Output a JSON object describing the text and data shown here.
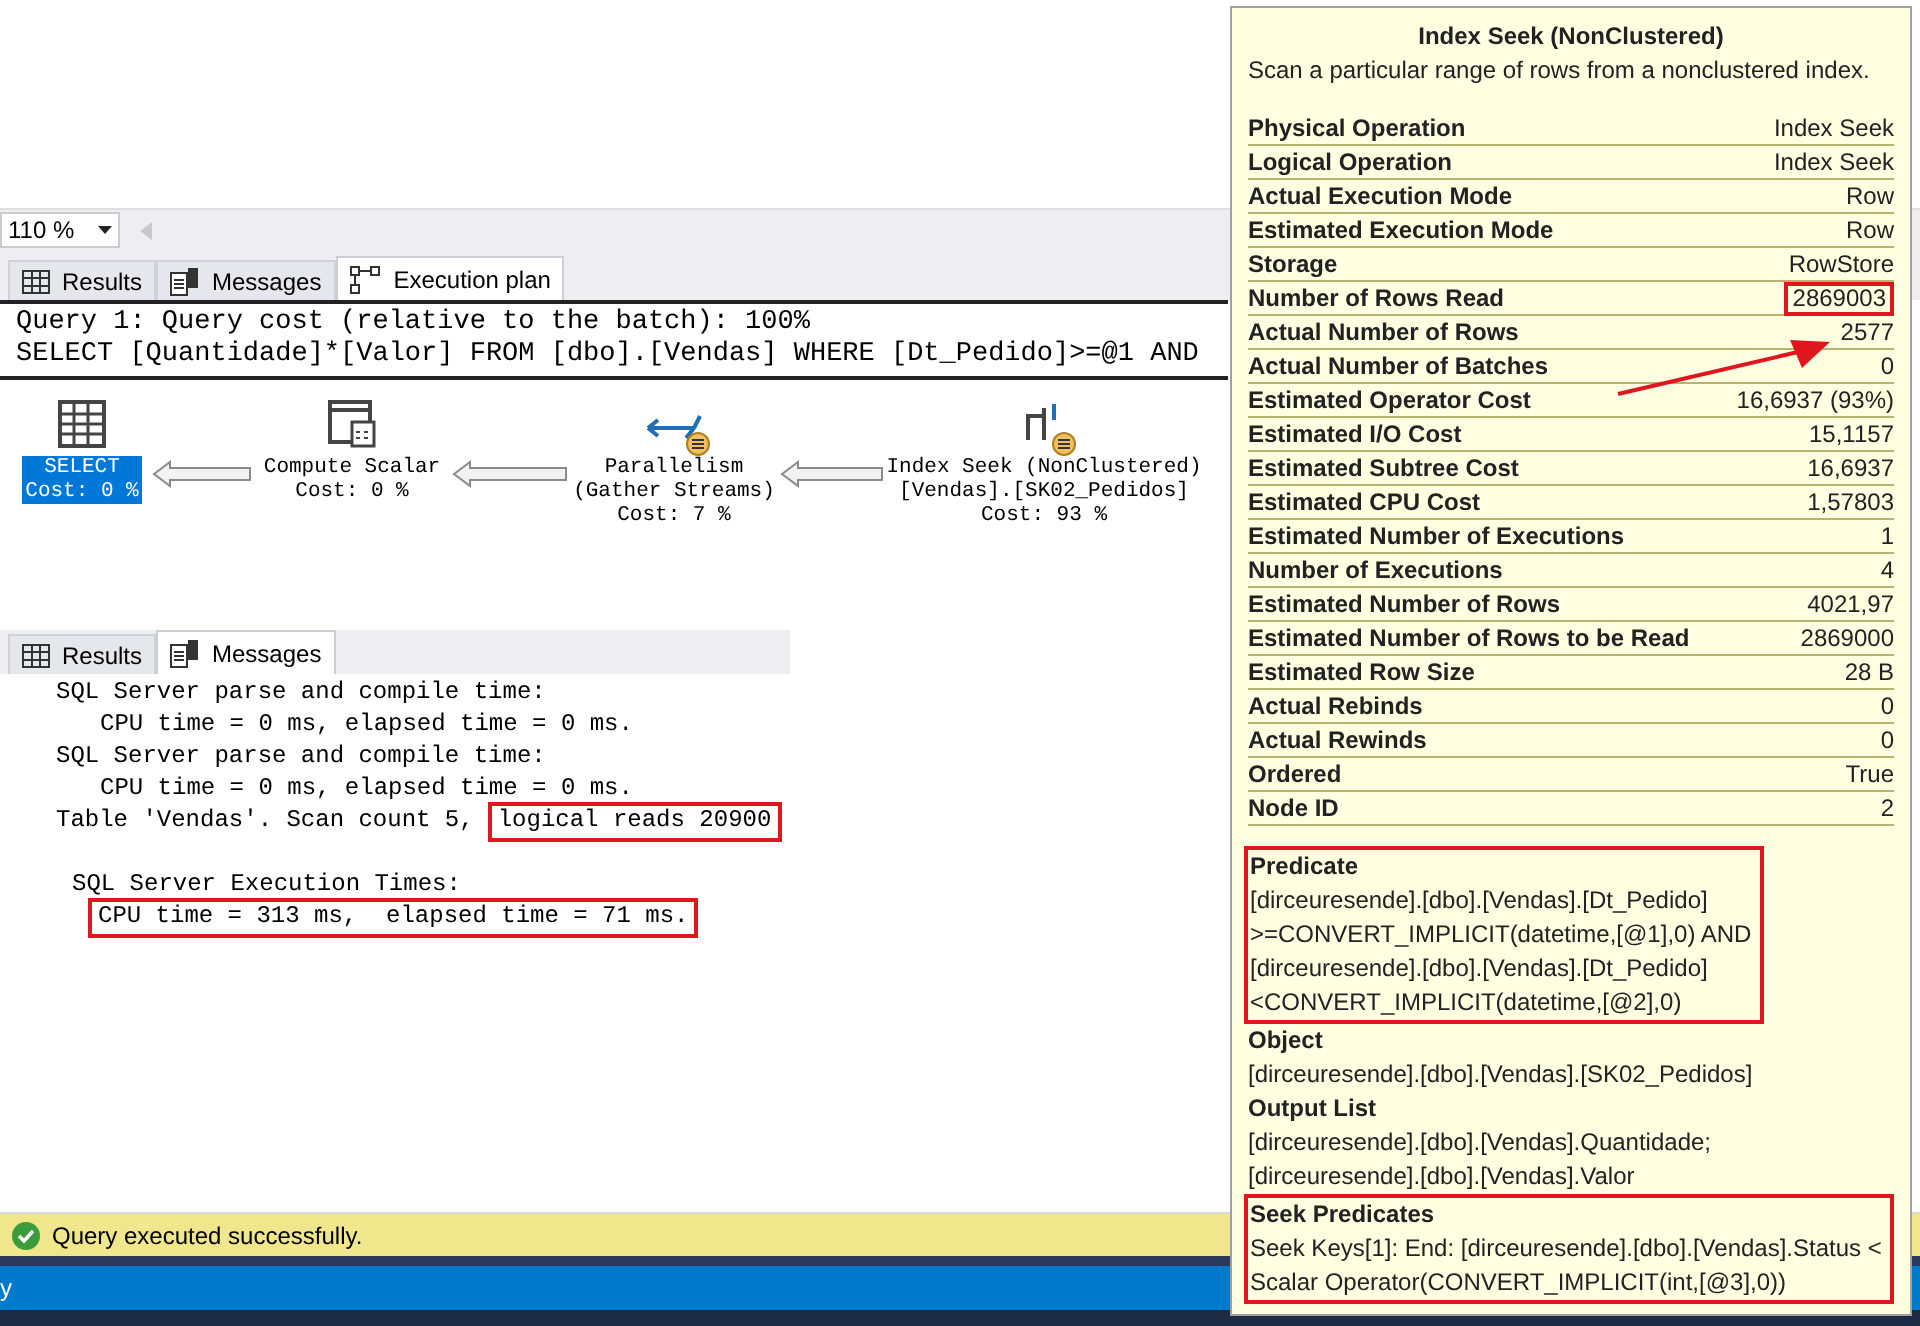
{
  "zoom": {
    "value": "110 %"
  },
  "tabs": [
    {
      "label": "Results",
      "kind": "grid",
      "selected": false
    },
    {
      "label": "Messages",
      "kind": "messages",
      "selected": false
    },
    {
      "label": "Execution plan",
      "kind": "plan",
      "selected": true
    }
  ],
  "query": {
    "header": "Query 1: Query cost (relative to the batch): 100%",
    "statement": "SELECT [Quantidade]*[Valor] FROM [dbo].[Vendas] WHERE [Dt_Pedido]>=@1 AND"
  },
  "plan_nodes": [
    {
      "kind": "select",
      "lines": [
        "SELECT"
      ],
      "cost": "Cost: 0 %",
      "selected": true,
      "parallel": false
    },
    {
      "kind": "compute",
      "lines": [
        "Compute Scalar"
      ],
      "cost": "Cost: 0 %",
      "selected": false,
      "parallel": false
    },
    {
      "kind": "parallelism",
      "lines": [
        "Parallelism",
        "(Gather Streams)"
      ],
      "cost": "Cost: 7 %",
      "selected": false,
      "parallel": true
    },
    {
      "kind": "seek",
      "lines": [
        "Index Seek (NonClustered)",
        "[Vendas].[SK02_Pedidos]"
      ],
      "cost": "Cost: 93 %",
      "selected": false,
      "parallel": true
    }
  ],
  "lower_tabs": [
    {
      "label": "Results",
      "kind": "grid",
      "selected": false
    },
    {
      "label": "Messages",
      "kind": "messages",
      "selected": true
    }
  ],
  "messages": [
    {
      "kind": "heading",
      "segments": [
        {
          "text": "SQL Server parse and compile time:",
          "highlighted": false
        }
      ]
    },
    {
      "kind": "detail",
      "segments": [
        {
          "text": "CPU time = 0 ms, elapsed time = 0 ms.",
          "highlighted": false
        }
      ]
    },
    {
      "kind": "heading",
      "segments": [
        {
          "text": "SQL Server parse and compile time:",
          "highlighted": false
        }
      ]
    },
    {
      "kind": "detail",
      "segments": [
        {
          "text": "CPU time = 0 ms, elapsed time = 0 ms.",
          "highlighted": false
        }
      ]
    },
    {
      "kind": "heading",
      "segments": [
        {
          "text": "Table 'Vendas'. Scan count 5,",
          "highlighted": false
        },
        {
          "text": "logical reads 20900",
          "highlighted": true
        }
      ]
    },
    {
      "kind": "blank"
    },
    {
      "kind": "stat_heading",
      "segments": [
        {
          "text": "SQL Server Execution Times:",
          "highlighted": false
        }
      ]
    },
    {
      "kind": "stat_detail",
      "segments": [
        {
          "text": "CPU time = 313 ms,  elapsed time = 71 ms.",
          "highlighted": true
        }
      ]
    }
  ],
  "status_bar": {
    "text": "Query executed successfully."
  },
  "bottom_bar": {
    "text": "y"
  },
  "tooltip": {
    "title": "Index Seek (NonClustered)",
    "description": "Scan a particular range of rows from a nonclustered index.",
    "properties": [
      {
        "label": "Physical Operation",
        "value": "Index Seek",
        "highlighted": false
      },
      {
        "label": "Logical Operation",
        "value": "Index Seek",
        "highlighted": false
      },
      {
        "label": "Actual Execution Mode",
        "value": "Row",
        "highlighted": false
      },
      {
        "label": "Estimated Execution Mode",
        "value": "Row",
        "highlighted": false
      },
      {
        "label": "Storage",
        "value": "RowStore",
        "highlighted": false
      },
      {
        "label": "Number of Rows Read",
        "value": "2869003",
        "highlighted": true
      },
      {
        "label": "Actual Number of Rows",
        "value": "2577",
        "highlighted": false
      },
      {
        "label": "Actual Number of Batches",
        "value": "0",
        "highlighted": false
      },
      {
        "label": "Estimated Operator Cost",
        "value": "16,6937 (93%)",
        "highlighted": false
      },
      {
        "label": "Estimated I/O Cost",
        "value": "15,1157",
        "highlighted": false
      },
      {
        "label": "Estimated Subtree Cost",
        "value": "16,6937",
        "highlighted": false
      },
      {
        "label": "Estimated CPU Cost",
        "value": "1,57803",
        "highlighted": false
      },
      {
        "label": "Estimated Number of Executions",
        "value": "1",
        "highlighted": false
      },
      {
        "label": "Number of Executions",
        "value": "4",
        "highlighted": false
      },
      {
        "label": "Estimated Number of Rows",
        "value": "4021,97",
        "highlighted": false
      },
      {
        "label": "Estimated Number of Rows to be Read",
        "value": "2869000",
        "highlighted": false
      },
      {
        "label": "Estimated Row Size",
        "value": "28 B",
        "highlighted": false
      },
      {
        "label": "Actual Rebinds",
        "value": "0",
        "highlighted": false
      },
      {
        "label": "Actual Rewinds",
        "value": "0",
        "highlighted": false
      },
      {
        "label": "Ordered",
        "value": "True",
        "highlighted": false
      },
      {
        "label": "Node ID",
        "value": "2",
        "highlighted": false
      }
    ],
    "sections": [
      {
        "heading": "Predicate",
        "lines": [
          "[dirceuresende].[dbo].[Vendas].[Dt_Pedido]",
          ">=CONVERT_IMPLICIT(datetime,[@1],0) AND",
          "[dirceuresende].[dbo].[Vendas].[Dt_Pedido]",
          "<CONVERT_IMPLICIT(datetime,[@2],0)"
        ],
        "highlighted": true
      },
      {
        "heading": "Object",
        "lines": [
          "[dirceuresende].[dbo].[Vendas].[SK02_Pedidos]"
        ],
        "highlighted": false
      },
      {
        "heading": "Output List",
        "lines": [
          "[dirceuresende].[dbo].[Vendas].Quantidade;",
          "[dirceuresende].[dbo].[Vendas].Valor"
        ],
        "highlighted": false
      },
      {
        "heading": "Seek Predicates",
        "lines": [
          "Seek Keys[1]: End: [dirceuresende].[dbo].[Vendas].Status <",
          "Scalar Operator(CONVERT_IMPLICIT(int,[@3],0))"
        ],
        "highlighted": true
      }
    ]
  }
}
